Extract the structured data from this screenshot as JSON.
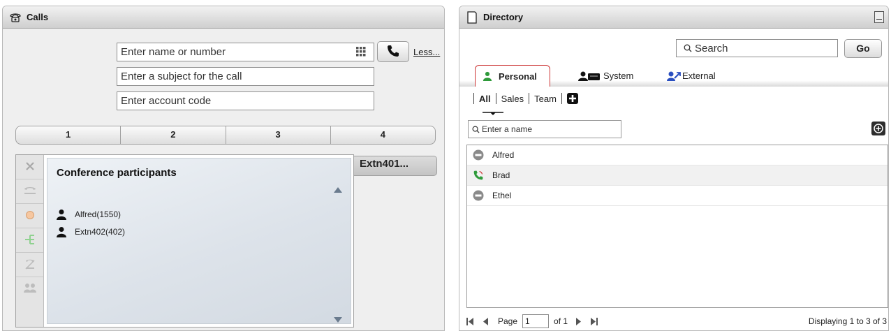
{
  "calls_panel": {
    "title": "Calls",
    "number_input_placeholder": "Enter name or number",
    "subject_input_placeholder": "Enter a subject for the call",
    "account_input_placeholder": "Enter account code",
    "less_link": "Less...",
    "call_tabs": [
      "1",
      "2",
      "3",
      "4"
    ],
    "active_call_label": "Extn401...",
    "conference": {
      "title": "Conference participants",
      "participants": [
        "Alfred(1550)",
        "Extn402(402)"
      ]
    }
  },
  "directory_panel": {
    "title": "Directory",
    "search_placeholder": "Search",
    "go_label": "Go",
    "tabs": [
      "Personal",
      "System",
      "External"
    ],
    "active_tab": "Personal",
    "groups": [
      "All",
      "Sales",
      "Team"
    ],
    "active_group": "All",
    "name_filter_placeholder": "Enter a name",
    "contacts": [
      {
        "name": "Alfred",
        "status": "busy"
      },
      {
        "name": "Brad",
        "status": "ringing"
      },
      {
        "name": "Ethel",
        "status": "busy"
      }
    ],
    "pager": {
      "page_label": "Page",
      "page_value": "1",
      "of_label": "of 1",
      "summary": "Displaying 1 to 3 of 3"
    }
  },
  "colors": {
    "accent_red": "#cc3333",
    "green": "#2e9a3a",
    "blue": "#2a4fc0"
  }
}
